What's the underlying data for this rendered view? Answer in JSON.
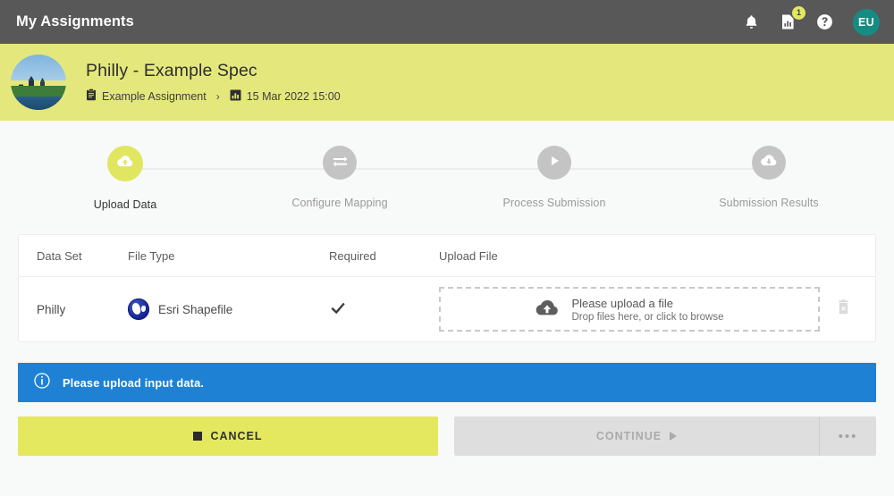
{
  "topbar": {
    "title": "My Assignments",
    "icons": [
      {
        "name": "notifications-bell-icon"
      },
      {
        "name": "reports-chart-icon",
        "badge": "1"
      },
      {
        "name": "help-question-icon"
      }
    ],
    "avatar_initials": "EU",
    "avatar_color": "#168b82",
    "background": "#585858"
  },
  "page_header": {
    "background": "#e4e87c",
    "spec_avatar_name": "philadelphia-skyline-thumbnail",
    "title": "Philly - Example Spec",
    "breadcrumb": {
      "assignment_label": "Example Assignment",
      "separator": "›",
      "date_label": "15 Mar 2022 15:00"
    }
  },
  "stepper": {
    "active_index": 0,
    "steps": [
      {
        "label": "Upload Data",
        "icon": "cloud-upload-icon",
        "state": "active"
      },
      {
        "label": "Configure Mapping",
        "icon": "transfer-arrows-icon",
        "state": "inactive"
      },
      {
        "label": "Process Submission",
        "icon": "play-triangle-icon",
        "state": "inactive"
      },
      {
        "label": "Submission Results",
        "icon": "cloud-download-icon",
        "state": "inactive"
      }
    ],
    "active_color": "#e1e660",
    "inactive_color": "#c4c4c4"
  },
  "table": {
    "columns": [
      "Data Set",
      "File Type",
      "Required",
      "Upload File"
    ],
    "rows": [
      {
        "data_set": "Philly",
        "file_type": "Esri Shapefile",
        "file_type_icon": "esri-globe-icon",
        "required": true,
        "required_icon": "checkmark-icon",
        "upload": {
          "icon": "cloud-upload-icon",
          "primary": "Please upload a file",
          "secondary": "Drop files here, or click to browse"
        },
        "delete_icon": "trash-delete-icon"
      }
    ]
  },
  "info_banner": {
    "icon": "info-circle-icon",
    "message": "Please upload input data.",
    "color": "#1f81d4"
  },
  "actions": {
    "cancel_label": "CANCEL",
    "cancel_icon": "stop-square-icon",
    "cancel_color": "#e4e85e",
    "continue_label": "CONTINUE",
    "continue_icon": "play-triangle-icon",
    "continue_disabled": true,
    "more_label": "•••",
    "more_icon": "ellipsis-icon"
  }
}
